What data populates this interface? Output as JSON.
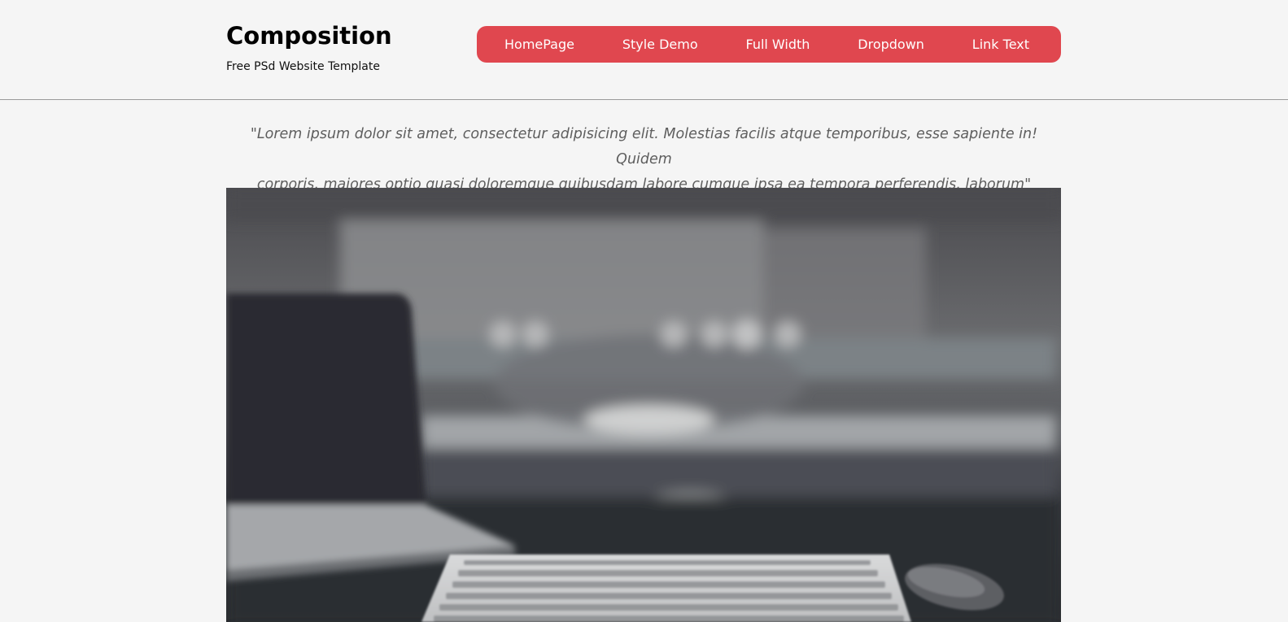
{
  "header": {
    "site_title": "Composition",
    "site_subtitle": "Free PSd Website Template"
  },
  "nav": {
    "accent_color": "#e0474f",
    "items": [
      {
        "label": "HomePage"
      },
      {
        "label": "Style Demo"
      },
      {
        "label": "Full Width"
      },
      {
        "label": "Dropdown"
      },
      {
        "label": "Link Text"
      }
    ]
  },
  "main": {
    "quote_line1": "\"Lorem ipsum dolor sit amet, consectetur adipisicing elit. Molestias facilis atque temporibus, esse sapiente in! Quidem",
    "quote_line2": "corporis, maiores optio quasi doloremque quibusdam labore cumque ipsa ea tempora perferendis, laborum\""
  }
}
